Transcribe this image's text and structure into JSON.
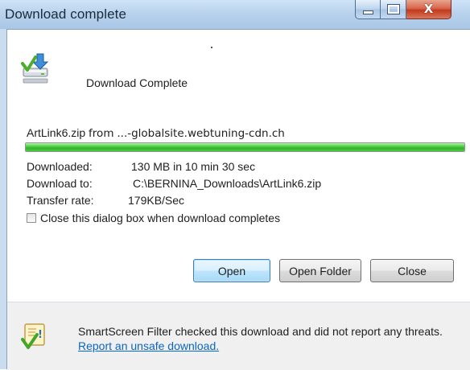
{
  "window": {
    "title": "Download complete",
    "buttons": {
      "minimize": "minimize",
      "maximize": "maximize",
      "close": "X"
    }
  },
  "header": {
    "title": "Download Complete",
    "icon": "download-complete-icon"
  },
  "download": {
    "filename": "ArtLink6.zip",
    "from_word": "from",
    "source": "...-globalsite.webtuning-cdn.ch",
    "progress": 1.0,
    "details": [
      {
        "label": "Downloaded:",
        "value": "130 MB in 10 min 30 sec"
      },
      {
        "label": "Download to:",
        "value": "C:\\BERNINA_Downloads\\ArtLink6.zip"
      },
      {
        "label": "Transfer rate:",
        "value": "179KB/Sec"
      }
    ],
    "close_checkbox": {
      "label": "Close this dialog box when download completes",
      "checked": false
    }
  },
  "actions": {
    "open": "Open",
    "open_folder": "Open Folder",
    "close": "Close"
  },
  "footer": {
    "icon": "smartscreen-shield-icon",
    "text": "SmartScreen Filter checked this download and did not report any threats.",
    "link": "Report an unsafe download."
  },
  "colors": {
    "titlebar": "#b9d2ec",
    "progress_fill": "#2fb626",
    "link": "#0a66c2",
    "close_button": "#c23a1e"
  }
}
